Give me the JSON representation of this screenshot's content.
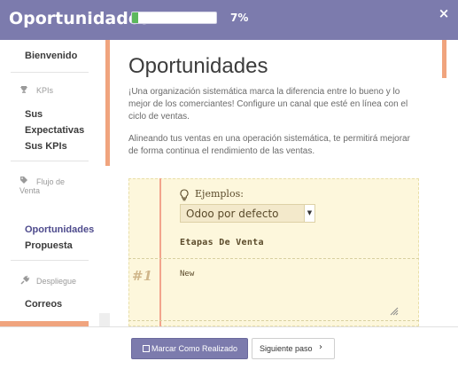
{
  "header": {
    "title": "Oportunidades",
    "progress_percent": 7,
    "progress_text": "7%",
    "close_icon": "×"
  },
  "sidebar": {
    "welcome": "Bienvenido",
    "sections": [
      {
        "icon": "trophy-icon",
        "label": "KPIs",
        "items": [
          "Sus Expectativas",
          "Sus KPIs"
        ]
      },
      {
        "icon": "tag-icon",
        "label": "Flujo de Venta",
        "items": [
          "Oportunidades",
          "Propuesta"
        ]
      },
      {
        "icon": "plug-icon",
        "label": "Despliegue",
        "items": [
          "Correos"
        ]
      }
    ],
    "item_sus": "Sus",
    "item_expectativas": "Expectativas",
    "item_sus_kpis": "Sus KPIs",
    "section_flujo_line1": "Flujo de",
    "section_flujo_line2": "Venta",
    "active_item": "Oportunidades"
  },
  "main": {
    "title": "Oportunidades",
    "paragraph1": "¡Una organización sistemática marca la diferencia entre lo bueno y lo mejor de los comerciantes! Configure un canal que esté en línea con el ciclo de ventas.",
    "paragraph2": "Alineando tus ventas en una operación sistemática, te permitirá mejorar de forma continua el rendimiento de las ventas.",
    "example_card": {
      "examples_label": "Ejemplos:",
      "select_value": "Odoo por defecto",
      "stages_heading": "Etapas De Venta",
      "stage_number": "#1",
      "stage_value": "New"
    }
  },
  "footer": {
    "mark_done_label": "Marcar Como Realizado",
    "next_step_label": "Siguiente paso",
    "next_chevron": "›"
  },
  "colors": {
    "header_bg": "#7c7bad",
    "accent_orange": "#f0a47e",
    "progress_green": "#5cb85c",
    "card_bg": "#fdf7dc",
    "active_link": "#4d4a8c"
  }
}
